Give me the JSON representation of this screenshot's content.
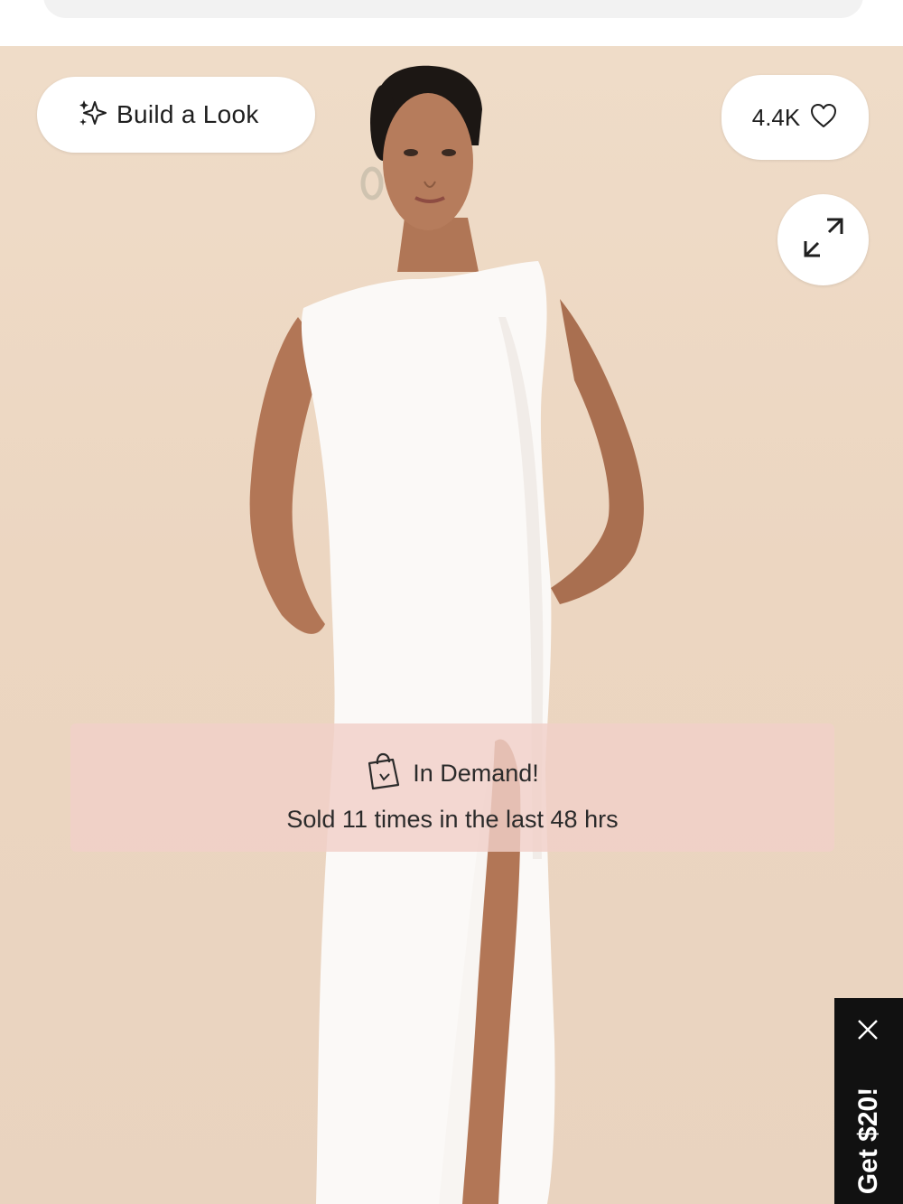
{
  "header": {
    "search_bar": ""
  },
  "product_image": {
    "alt": "Woman wearing white sleeveless maxi dress with side slit",
    "background_color": "#ecd6c1",
    "dress_color": "#ffffff"
  },
  "build_look": {
    "label": "Build a Look",
    "icon": "sparkles-icon"
  },
  "wishlist": {
    "count": "4.4K",
    "icon": "heart-icon"
  },
  "expand": {
    "icon": "expand-icon"
  },
  "in_demand": {
    "title": "In Demand!",
    "subtitle": "Sold 11 times in the last 48 hrs",
    "icon": "shopping-bag-icon",
    "background_color": "#f0d0c8"
  },
  "promo_tab": {
    "label": "Get $20!",
    "close_icon": "close-icon",
    "background_color": "#111111"
  }
}
